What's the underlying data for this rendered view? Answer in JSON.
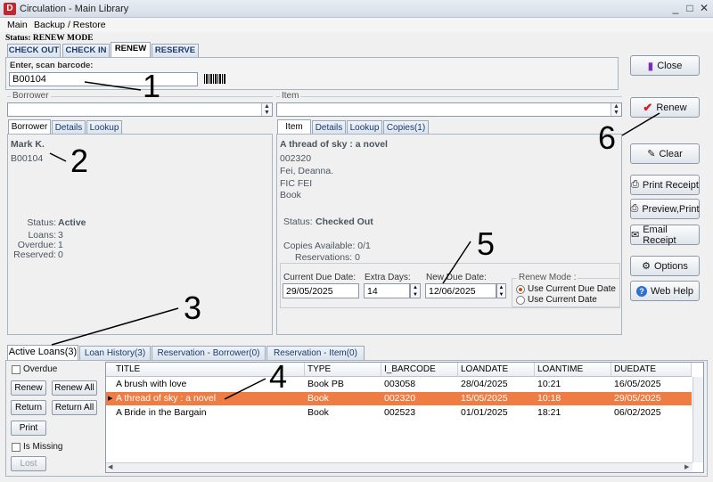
{
  "window": {
    "title": "Circulation - Main Library",
    "app_letter": "D",
    "controls": [
      "_",
      "□",
      "✕"
    ]
  },
  "menu": [
    "Main",
    "Backup / Restore"
  ],
  "status": "Status: RENEW MODE",
  "mode_tabs": [
    "CHECK OUT",
    "CHECK IN",
    "RENEW",
    "RESERVE"
  ],
  "barcode": {
    "label": "Enter, scan barcode:",
    "value": "B00104"
  },
  "borrower": {
    "group": "Borrower",
    "tabs": [
      "Borrower",
      "Details",
      "Lookup"
    ],
    "name": "Mark K.",
    "id": "B00104",
    "status_label": "Status:",
    "status_value": "Active",
    "loans_label": "Loans:",
    "loans": "3",
    "overdue_label": "Overdue:",
    "overdue": "1",
    "reserved_label": "Reserved:",
    "reserved": "0"
  },
  "item": {
    "group": "Item",
    "tabs": [
      "Item",
      "Details",
      "Lookup",
      "Copies(1)"
    ],
    "title": "A thread of sky : a novel",
    "barcode": "002320",
    "author": "Fei, Deanna.",
    "call": "FIC FEI",
    "type": "Book",
    "status_label": "Status:",
    "status_value": "Checked Out",
    "copies": "Copies Available:  0/1",
    "reservations": "Reservations:  0"
  },
  "due": {
    "current_label": "Current Due Date:",
    "current": "29/05/2025",
    "extra_label": "Extra Days:",
    "extra": "14",
    "new_label": "New Due Date:",
    "new": "12/06/2025",
    "mode_label": "Renew Mode :",
    "mode_opts": [
      "Use Current Due Date",
      "Use Current Date"
    ]
  },
  "buttons": {
    "close": "Close",
    "renew": "Renew",
    "clear": "Clear",
    "print_receipt": "Print Receipt",
    "preview": "Preview,Print",
    "email": "Email Receipt",
    "options": "Options",
    "help": "Web Help"
  },
  "callouts": [
    "1",
    "2",
    "3",
    "4",
    "5",
    "6"
  ],
  "bottom_tabs": [
    "Active Loans(3)",
    "Loan History(3)",
    "Reservation - Borrower(0)",
    "Reservation - Item(0)"
  ],
  "left_controls": {
    "overdue": "Overdue",
    "renew": "Renew",
    "renew_all": "Renew All",
    "return": "Return",
    "return_all": "Return All",
    "print": "Print",
    "missing": "Is Missing",
    "lost": "Lost"
  },
  "table": {
    "headers": [
      "TITLE",
      "TYPE",
      "I_BARCODE",
      "LOANDATE",
      "LOANTIME",
      "DUEDATE"
    ],
    "rows": [
      [
        "A brush with love",
        "Book PB",
        "003058",
        "28/04/2025",
        "10:21",
        "16/05/2025"
      ],
      [
        "A thread of sky : a novel",
        "Book",
        "002320",
        "15/05/2025",
        "10:18",
        "29/05/2025"
      ],
      [
        "A Bride in the Bargain",
        "Book",
        "002523",
        "01/01/2025",
        "18:21",
        "06/02/2025"
      ]
    ]
  },
  "colors": {
    "selected_row": "#ee7c43",
    "accent": "#1b3a6b"
  }
}
